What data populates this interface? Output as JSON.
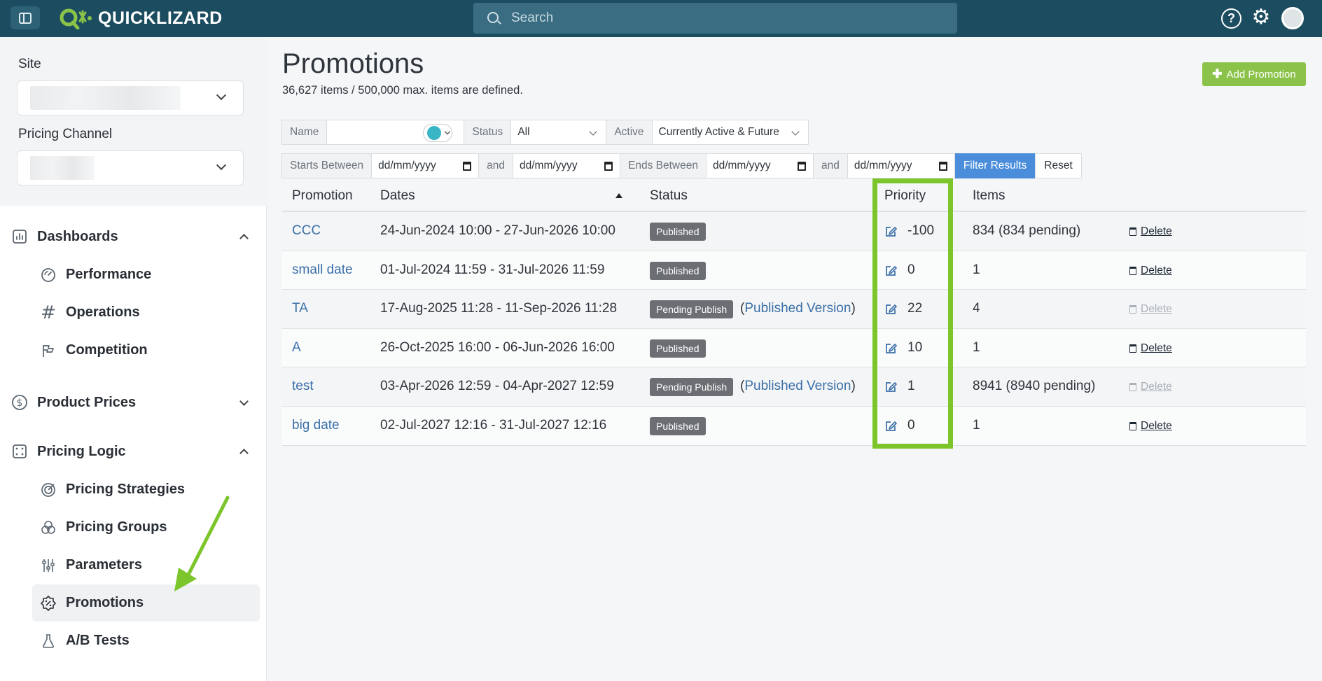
{
  "topbar": {
    "brand": "QUICKLIZARD",
    "search_placeholder": "Search",
    "help_glyph": "?",
    "icons": [
      "sidebar-toggle-icon",
      "search-icon",
      "help-icon",
      "gear-icon",
      "avatar"
    ]
  },
  "sidebar": {
    "site_label": "Site",
    "channel_label": "Pricing Channel",
    "sections": {
      "dashboards": {
        "label": "Dashboards",
        "expanded": true
      },
      "product_prices": {
        "label": "Product Prices",
        "expanded": false
      },
      "pricing_logic": {
        "label": "Pricing Logic",
        "expanded": true
      }
    },
    "dashboard_items": [
      "Performance",
      "Operations",
      "Competition"
    ],
    "logic_items": [
      "Pricing Strategies",
      "Pricing Groups",
      "Parameters",
      "Promotions",
      "A/B Tests"
    ],
    "active_item": "Promotions"
  },
  "main": {
    "title": "Promotions",
    "subtitle": "36,627 items / 500,000 max. items are defined.",
    "add_button": "Add Promotion",
    "filters": {
      "name_label": "Name",
      "status_label": "Status",
      "status_value": "All",
      "active_label": "Active",
      "active_value": "Currently Active & Future",
      "starts_label": "Starts Between",
      "and_label": "and",
      "ends_label": "Ends Between",
      "date_placeholder": "dd/mm/yyyy",
      "filter_button": "Filter Results",
      "reset_button": "Reset"
    },
    "table": {
      "headers": [
        "Promotion",
        "Dates",
        "Status",
        "Priority",
        "Items"
      ],
      "sorted_column": "Dates",
      "published_version_link": "Published Version",
      "delete_label": "Delete",
      "rows": [
        {
          "promotion": "CCC",
          "dates": "24-Jun-2024 10:00 - 27-Jun-2026 10:00",
          "status": "Published",
          "priority": "-100",
          "items": "834 (834 pending)",
          "delete_enabled": true
        },
        {
          "promotion": "small date",
          "dates": "01-Jul-2024 11:59 - 31-Jul-2026 11:59",
          "status": "Published",
          "priority": "0",
          "items": "1",
          "delete_enabled": true
        },
        {
          "promotion": "TA",
          "dates": "17-Aug-2025 11:28 - 11-Sep-2026 11:28",
          "status": "Pending Publish",
          "priority": "22",
          "items": "4",
          "delete_enabled": false
        },
        {
          "promotion": "A",
          "dates": "26-Oct-2025 16:00 - 06-Jun-2026 16:00",
          "status": "Published",
          "priority": "10",
          "items": "1",
          "delete_enabled": true
        },
        {
          "promotion": "test",
          "dates": "03-Apr-2026 12:59 - 04-Apr-2027 12:59",
          "status": "Pending Publish",
          "priority": "1",
          "items": "8941 (8940 pending)",
          "delete_enabled": false
        },
        {
          "promotion": "big date",
          "dates": "02-Jul-2027 12:16 - 31-Jul-2027 12:16",
          "status": "Published",
          "priority": "0",
          "items": "1",
          "delete_enabled": true
        }
      ]
    }
  },
  "colors": {
    "topbar": "#1b4c5f",
    "accent_green": "#8bc34a",
    "highlight_green": "#7cc62b",
    "filter_blue": "#4a8ddb",
    "link_blue": "#3a6fa8",
    "badge_gray": "#6b6e72"
  }
}
